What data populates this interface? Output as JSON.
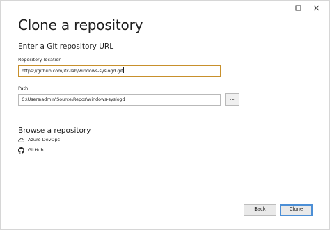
{
  "window": {
    "controls": [
      "minimize-icon",
      "maximize-icon",
      "close-icon"
    ]
  },
  "title": "Clone a repository",
  "url_section": {
    "heading": "Enter a Git repository URL",
    "repo_location_label": "Repository location",
    "repo_location_value": "https://github.com/itc-lab/windows-syslogd.git",
    "path_label": "Path",
    "path_value": "C:\\Users\\admin\\Source\\Repos\\windows-syslogd",
    "browse_button_label": "..."
  },
  "browse_section": {
    "heading": "Browse a repository",
    "providers": [
      {
        "label": "Azure DevOps",
        "icon": "cloud-icon"
      },
      {
        "label": "GitHub",
        "icon": "github-icon"
      }
    ]
  },
  "footer": {
    "back_label": "Back",
    "clone_label": "Clone"
  },
  "colors": {
    "focused_input_border": "#c8902c",
    "default_button_border": "#4c8fd6"
  }
}
